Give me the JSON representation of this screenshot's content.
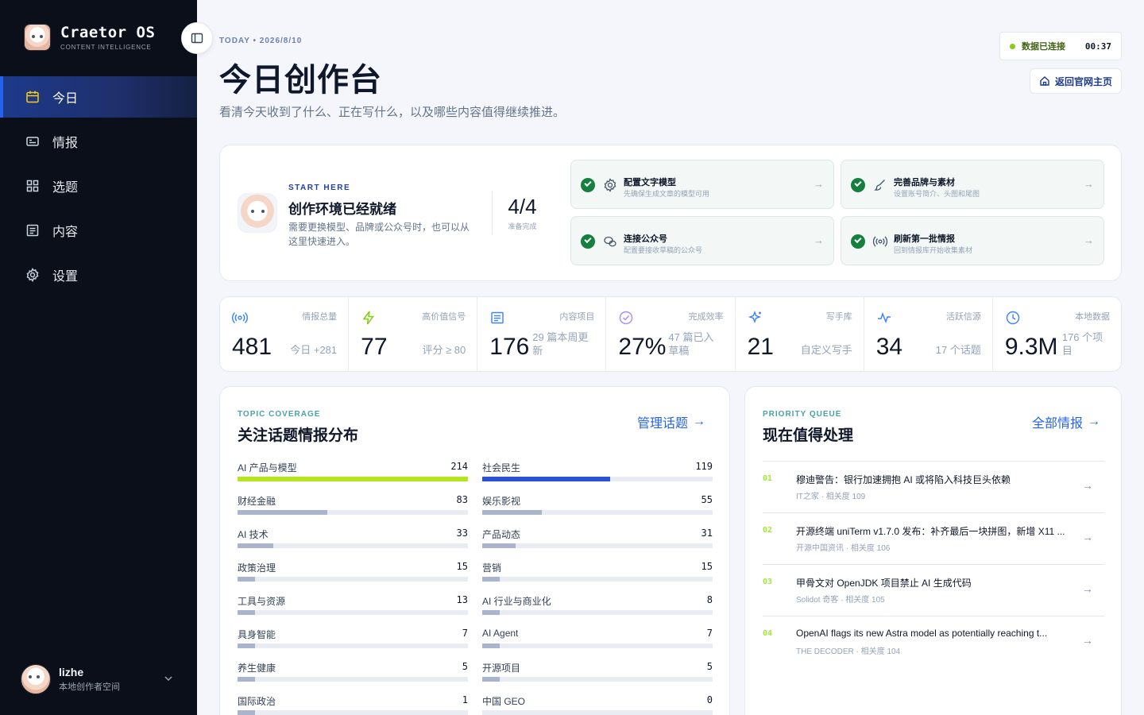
{
  "brand": {
    "name": "Craetor OS",
    "subtitle": "CONTENT INTELLIGENCE"
  },
  "nav": [
    {
      "label": "今日",
      "icon": "calendar-icon",
      "active": true
    },
    {
      "label": "情报",
      "icon": "inbox-icon",
      "active": false
    },
    {
      "label": "选题",
      "icon": "grid-icon",
      "active": false
    },
    {
      "label": "内容",
      "icon": "document-icon",
      "active": false
    },
    {
      "label": "设置",
      "icon": "gear-icon",
      "active": false
    }
  ],
  "user": {
    "name": "lizhe",
    "subtitle": "本地创作者空间"
  },
  "header": {
    "date_line": "TODAY • 2026/8/10",
    "title": "今日创作台",
    "subtitle": "看清今天收到了什么、正在写什么，以及哪些内容值得继续推进。",
    "status_text": "数据已连接",
    "status_time": "00:37",
    "home_label": "返回官网主页"
  },
  "start": {
    "kicker": "START HERE",
    "title": "创作环境已经就绪",
    "desc": "需要更换模型、品牌或公众号时，也可以从这里快速进入。",
    "progress_value": "4/4",
    "progress_label": "准备完成",
    "tasks": [
      {
        "title": "配置文字模型",
        "desc": "先确保生成文章的模型可用",
        "icon": "gear-icon"
      },
      {
        "title": "完善品牌与素材",
        "desc": "设置账号简介、头图和尾图",
        "icon": "brush-icon"
      },
      {
        "title": "连接公众号",
        "desc": "配置要接收草稿的公众号",
        "icon": "wechat-icon"
      },
      {
        "title": "刷新第一批情报",
        "desc": "回到情报库开始收集素材",
        "icon": "broadcast-icon"
      }
    ]
  },
  "stats": [
    {
      "label": "情报总量",
      "value": "481",
      "sub": "今日 +281",
      "icon": "broadcast-icon",
      "color": "#3b82f6"
    },
    {
      "label": "高价值信号",
      "value": "77",
      "sub": "评分 ≥ 80",
      "icon": "bolt-icon",
      "color": "#84cc16"
    },
    {
      "label": "内容项目",
      "value": "176",
      "sub": "29 篇本周更新",
      "icon": "document-icon",
      "color": "#3b82f6"
    },
    {
      "label": "完成效率",
      "value": "27%",
      "sub": "47 篇已入草稿",
      "icon": "check-circle-icon",
      "color": "#a78bfa"
    },
    {
      "label": "写手库",
      "value": "21",
      "sub": "自定义写手",
      "icon": "sparkle-icon",
      "color": "#3b82f6"
    },
    {
      "label": "活跃信源",
      "value": "34",
      "sub": "17 个话题",
      "icon": "pulse-icon",
      "color": "#3b82f6"
    },
    {
      "label": "本地数据",
      "value": "9.3M",
      "sub": "176 个项目",
      "icon": "clock-icon",
      "color": "#3b82f6"
    }
  ],
  "topics": {
    "kicker": "TOPIC COVERAGE",
    "title": "关注话题情报分布",
    "link": "管理话题",
    "left": [
      {
        "name": "AI 产品与模型",
        "count": 214,
        "fill": 1.0,
        "color": "#b5e61d"
      },
      {
        "name": "财经金融",
        "count": 83,
        "fill": 0.39,
        "color": "#aab4cc"
      },
      {
        "name": "AI 技术",
        "count": 33,
        "fill": 0.155,
        "color": "#aab4cc"
      },
      {
        "name": "政策治理",
        "count": 15,
        "fill": 0.075,
        "color": "#aab4cc"
      },
      {
        "name": "工具与资源",
        "count": 13,
        "fill": 0.075,
        "color": "#aab4cc"
      },
      {
        "name": "具身智能",
        "count": 7,
        "fill": 0.075,
        "color": "#aab4cc"
      },
      {
        "name": "养生健康",
        "count": 5,
        "fill": 0.075,
        "color": "#aab4cc"
      },
      {
        "name": "国际政治",
        "count": 1,
        "fill": 0.075,
        "color": "#aab4cc"
      }
    ],
    "right": [
      {
        "name": "社会民生",
        "count": 119,
        "fill": 0.556,
        "color": "#2a53d4"
      },
      {
        "name": "娱乐影视",
        "count": 55,
        "fill": 0.257,
        "color": "#aab4cc"
      },
      {
        "name": "产品动态",
        "count": 31,
        "fill": 0.145,
        "color": "#aab4cc"
      },
      {
        "name": "营销",
        "count": 15,
        "fill": 0.075,
        "color": "#aab4cc"
      },
      {
        "name": "AI 行业与商业化",
        "count": 8,
        "fill": 0.075,
        "color": "#aab4cc"
      },
      {
        "name": "AI Agent",
        "count": 7,
        "fill": 0.075,
        "color": "#aab4cc"
      },
      {
        "name": "开源项目",
        "count": 5,
        "fill": 0.075,
        "color": "#aab4cc"
      },
      {
        "name": "中国 GEO",
        "count": 0,
        "fill": 0.0,
        "color": "#aab4cc"
      }
    ]
  },
  "queue": {
    "kicker": "PRIORITY QUEUE",
    "title": "现在值得处理",
    "link": "全部情报",
    "items": [
      {
        "num": "01",
        "title": "穆迪警告：银行加速拥抱 AI 或将陷入科技巨头依赖",
        "meta": "IT之家 · 相关度 109"
      },
      {
        "num": "02",
        "title": "开源终端 uniTerm v1.7.0 发布：补齐最后一块拼图，新增 X11 ...",
        "meta": "开源中国资讯 · 相关度 106"
      },
      {
        "num": "03",
        "title": "甲骨文对 OpenJDK 项目禁止 AI 生成代码",
        "meta": "Solidot 奇客 · 相关度 105"
      },
      {
        "num": "04",
        "title": "OpenAI flags its new Astra model as potentially reaching t...",
        "meta": "THE DECODER · 相关度 104"
      }
    ]
  }
}
